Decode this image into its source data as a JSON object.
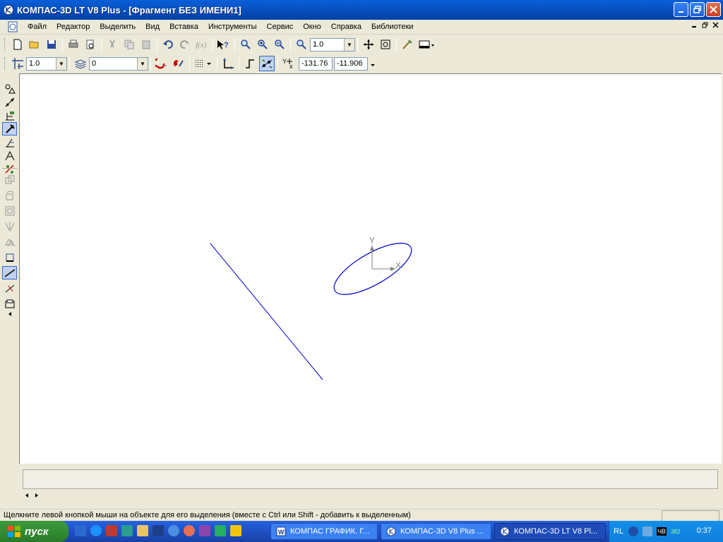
{
  "window": {
    "title": "КОМПАС-3D LT V8 Plus - [Фрагмент БЕЗ ИМЕНИ1]"
  },
  "menu": {
    "items": [
      "Файл",
      "Редактор",
      "Выделить",
      "Вид",
      "Вставка",
      "Инструменты",
      "Сервис",
      "Окно",
      "Справка",
      "Библиотеки"
    ]
  },
  "toolbar": {
    "zoom_value": "1.0",
    "step_value": "1.0",
    "layer_value": "0",
    "coord_x": "-131.76",
    "coord_y": "-11.906"
  },
  "canvas": {
    "axis_x_label": "X",
    "axis_y_label": "Y",
    "colors": {
      "geometry": "#0000cc",
      "axis": "#808080"
    }
  },
  "status": {
    "hint": "Щелкните левой кнопкой мыши на объекте для его выделения (вместе с Ctrl или Shift - добавить к выделенным)"
  },
  "taskbar": {
    "start_label": "пуск",
    "tasks": [
      {
        "label": "КОМПАС ГРАФИК. Г...",
        "active": false
      },
      {
        "label": "КОМПАС-3D V8 Plus ...",
        "active": false
      },
      {
        "label": "КОМПАС-3D LT V8 Pl...",
        "active": true
      }
    ],
    "lang": "RL",
    "tray_text_1": "ЧВ",
    "tray_text_2": "382",
    "clock": "0:37"
  }
}
